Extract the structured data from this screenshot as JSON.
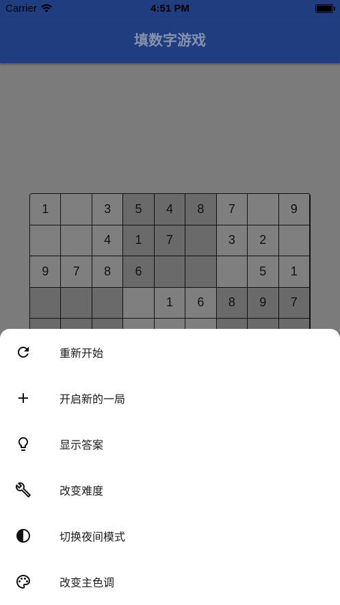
{
  "status_bar": {
    "carrier": "Carrier",
    "time": "4:51 PM"
  },
  "app_bar": {
    "title": "填数字游戏"
  },
  "board": {
    "rows": [
      [
        "1",
        "",
        "3",
        "5",
        "4",
        "8",
        "7",
        "",
        "9"
      ],
      [
        "",
        "",
        "4",
        "1",
        "7",
        "",
        "3",
        "2",
        ""
      ],
      [
        "9",
        "7",
        "8",
        "6",
        "",
        "",
        "",
        "5",
        "1"
      ],
      [
        "",
        "",
        "",
        "",
        "1",
        "6",
        "8",
        "9",
        "7"
      ],
      [
        "",
        "",
        "",
        "",
        "",
        "",
        "",
        "",
        ""
      ]
    ],
    "shade": [
      [
        "l",
        "l",
        "l",
        "d",
        "d",
        "d",
        "l",
        "l",
        "l"
      ],
      [
        "l",
        "l",
        "l",
        "d",
        "d",
        "d",
        "l",
        "l",
        "l"
      ],
      [
        "l",
        "l",
        "l",
        "d",
        "d",
        "d",
        "l",
        "l",
        "l"
      ],
      [
        "d",
        "d",
        "d",
        "l",
        "l",
        "l",
        "d",
        "d",
        "d"
      ],
      [
        "d",
        "d",
        "d",
        "l",
        "l",
        "l",
        "d",
        "d",
        "d"
      ]
    ]
  },
  "menu": {
    "items": [
      {
        "label": "重新开始",
        "icon": "refresh-icon"
      },
      {
        "label": "开启新的一局",
        "icon": "plus-icon"
      },
      {
        "label": "显示答案",
        "icon": "lightbulb-icon"
      },
      {
        "label": "改变难度",
        "icon": "wrench-icon"
      },
      {
        "label": "切换夜间模式",
        "icon": "contrast-icon"
      },
      {
        "label": "改变主色调",
        "icon": "palette-icon"
      }
    ]
  }
}
